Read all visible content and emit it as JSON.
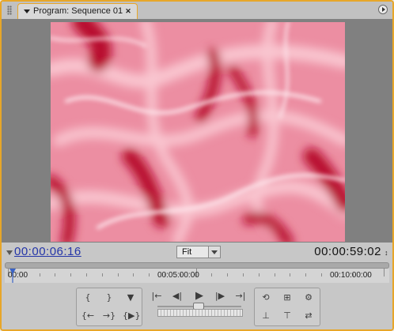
{
  "panel": {
    "tab_title": "Program: Sequence 01",
    "tab_close": "✕"
  },
  "timecode": {
    "current": "00:00:06:16",
    "duration": "00:00:59:02"
  },
  "zoom": {
    "selected": "Fit"
  },
  "ruler": {
    "labels": [
      "00:00",
      "00:05:00:00",
      "00:10:00:00"
    ],
    "playhead_position": 0.01
  },
  "video": {
    "colors": {
      "base": "#ec8ea2",
      "light": "#f9c6d0",
      "dark": "#b80f2e",
      "highlight": "#fde6ec"
    }
  },
  "icons": {
    "set_in": "set-in-point-icon",
    "set_out": "set-out-point-icon",
    "set_marker": "set-marker-icon",
    "go_in": "go-to-in-point-icon",
    "go_out": "go-to-out-point-icon",
    "play_in_out": "play-in-to-out-icon",
    "prev_edit": "go-to-previous-edit-icon",
    "step_back": "step-back-icon",
    "play": "play-icon",
    "step_fwd": "step-forward-icon",
    "next_edit": "go-to-next-edit-icon",
    "loop": "loop-icon",
    "safe_margins": "safe-margins-icon",
    "output": "output-icon",
    "lift": "lift-icon",
    "extract": "extract-icon",
    "trim": "trim-icon"
  }
}
